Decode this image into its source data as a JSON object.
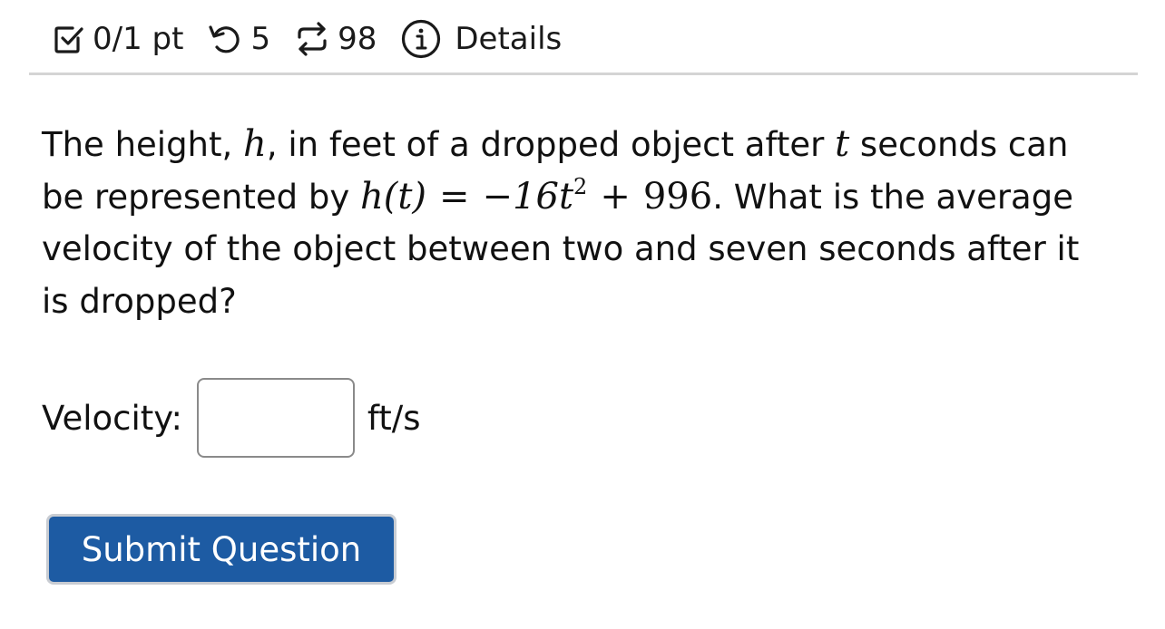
{
  "header": {
    "score": "0/1 pt",
    "retries": "5",
    "attempts": "98",
    "details_label": "Details",
    "icons": {
      "score": "checkbox-icon",
      "retries": "retry-icon",
      "attempts": "repeat-icon",
      "details": "info-icon"
    }
  },
  "question": {
    "part1": "The height, ",
    "var_h": "h",
    "part2": ", in feet of a dropped object after ",
    "var_t": "t",
    "part3": " seconds can",
    "part4": "be represented by ",
    "formula_lhs": "h(t)",
    "formula_eq": "=",
    "formula_coef": "−16t",
    "formula_exp": "2",
    "formula_plus": "+",
    "formula_const": "996",
    "part5": ". What is the average",
    "line3": "velocity of the object between two and seven seconds after it",
    "line4": "is dropped?"
  },
  "answer": {
    "label": "Velocity:",
    "value": "",
    "unit": "ft/s"
  },
  "submit": {
    "label": "Submit Question",
    "color": "#1d5ba3"
  }
}
